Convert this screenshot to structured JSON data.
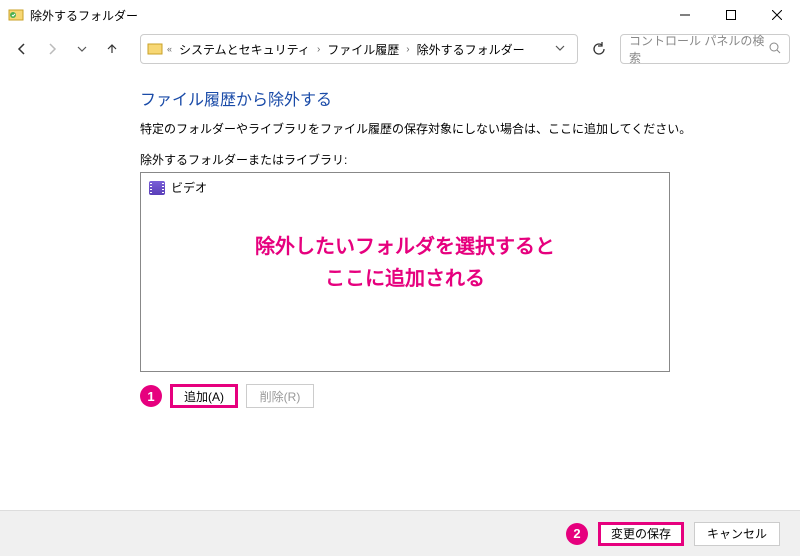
{
  "window": {
    "title": "除外するフォルダー"
  },
  "breadcrumb": {
    "prefix": "«",
    "seg1": "システムとセキュリティ",
    "seg2": "ファイル履歴",
    "seg3": "除外するフォルダー"
  },
  "search": {
    "placeholder": "コントロール パネルの検索"
  },
  "page": {
    "heading": "ファイル履歴から除外する",
    "description": "特定のフォルダーやライブラリをファイル履歴の保存対象にしない場合は、ここに追加してください。",
    "list_label": "除外するフォルダーまたはライブラリ:"
  },
  "folders": {
    "items": [
      {
        "name": "ビデオ",
        "icon": "video"
      }
    ]
  },
  "annotation": {
    "line1": "除外したいフォルダを選択すると",
    "line2": "ここに追加される"
  },
  "markers": {
    "m1": "1",
    "m2": "2"
  },
  "buttons": {
    "add": "追加(A)",
    "remove": "削除(R)",
    "save": "変更の保存",
    "cancel": "キャンセル"
  }
}
